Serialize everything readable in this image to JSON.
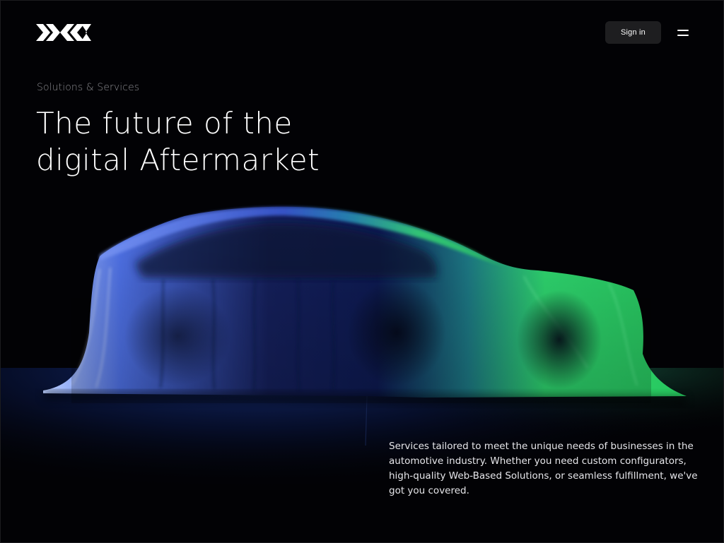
{
  "header": {
    "logo_alt": "XIX",
    "signin_label": "Sign in",
    "menu_icon": "hamburger-menu-icon"
  },
  "hero": {
    "eyebrow": "Solutions & Services",
    "headline_line1": "The future of the",
    "headline_line2": "digital Aftermarket",
    "image": "car-under-cover-photo"
  },
  "intro": {
    "text": "Services tailored to meet the unique needs of businesses in the automotive industry. Whether you need custom configurators, high-quality Web-Based Solutions, or seamless fulfillment, we've got you covered."
  },
  "colors": {
    "background": "#020205",
    "button_bg": "#1e1e20",
    "accent_blue": "#4a7bff",
    "accent_green": "#2fe06a"
  }
}
